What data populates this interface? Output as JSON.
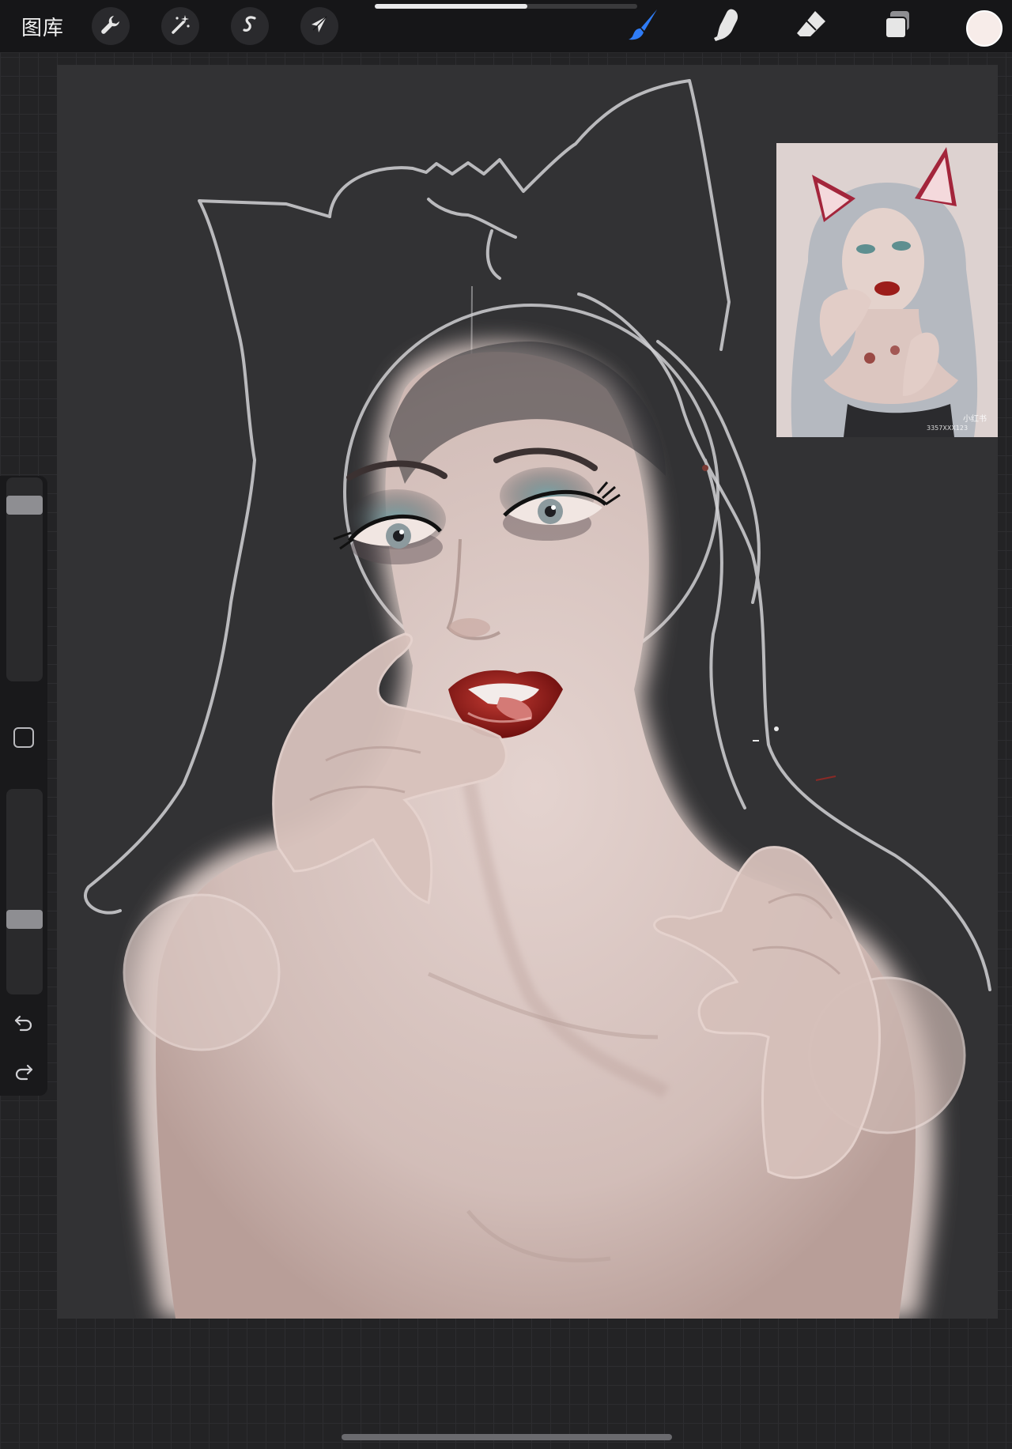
{
  "topbar": {
    "gallery_label": "图库",
    "left_tools": [
      {
        "name": "actions",
        "icon": "wrench-icon"
      },
      {
        "name": "adjustments",
        "icon": "magic-wand-icon"
      },
      {
        "name": "selection",
        "icon": "selection-s-icon"
      },
      {
        "name": "transform",
        "icon": "arrow-cursor-icon"
      }
    ],
    "right_tools": [
      {
        "name": "brush",
        "icon": "brush-icon",
        "active": true,
        "color": "#2f7cf6"
      },
      {
        "name": "smudge",
        "icon": "smudge-finger-icon",
        "active": false
      },
      {
        "name": "eraser",
        "icon": "eraser-icon",
        "active": false
      },
      {
        "name": "layers",
        "icon": "layers-icon",
        "active": false
      }
    ],
    "current_color": "#f7ece9",
    "progress": 0.58
  },
  "sidebar": {
    "brush_size_level": 0.9,
    "opacity_level": 0.35,
    "tools": [
      {
        "name": "modify",
        "icon": "square-modify-icon"
      },
      {
        "name": "undo",
        "icon": "undo-arrow-icon"
      },
      {
        "name": "redo",
        "icon": "redo-arrow-icon"
      }
    ]
  },
  "canvas": {
    "background_color": "#323234",
    "skin_color": "#d9c2bc",
    "lip_color": "#9c1d1a",
    "eyeshadow_color": "#6fa6ab",
    "reference_image": {
      "watermark_text": "小红书",
      "id_text": "3357XXX123"
    }
  }
}
